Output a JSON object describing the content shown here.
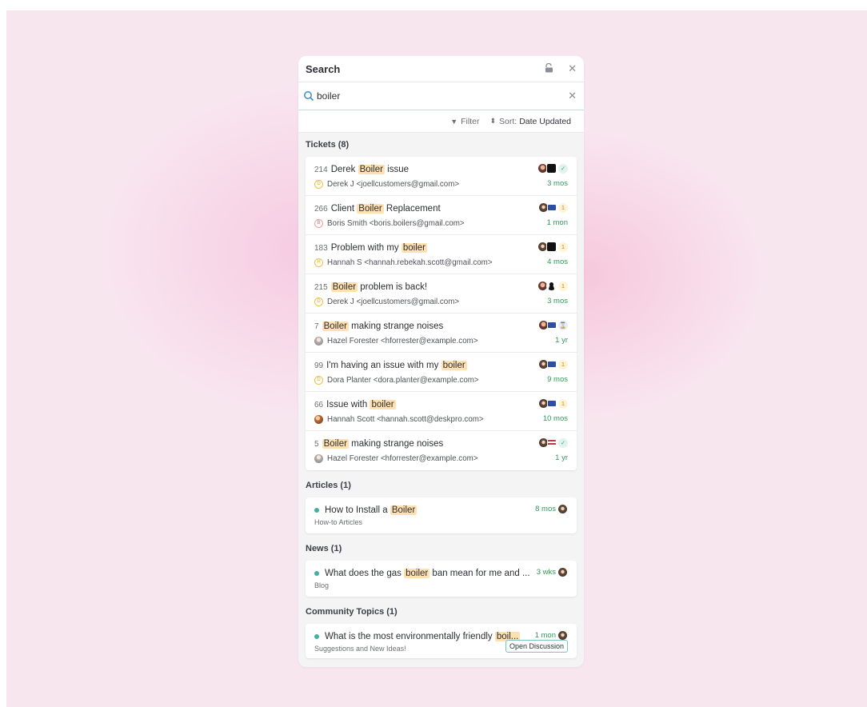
{
  "search_panel": {
    "title": "Search",
    "query": "boiler",
    "filter_label": "Filter",
    "sort_label": "Sort:",
    "sort_value": "Date Updated"
  },
  "sections": {
    "tickets": {
      "title": "Tickets (8)",
      "items": [
        {
          "id": "214",
          "pre": "Derek ",
          "hl": "Boiler",
          "post": " issue",
          "requester": "Derek J <joellcustomers@gmail.com>",
          "initial": "D",
          "age": "3 mos",
          "status": "✓"
        },
        {
          "id": "266",
          "pre": "Client ",
          "hl": "Boiler",
          "post": " Replacement",
          "requester": "Boris Smith <boris.boilers@gmail.com>",
          "initial": "B",
          "age": "1 mon",
          "status": "1"
        },
        {
          "id": "183",
          "pre": "Problem with my ",
          "hl": "boiler",
          "post": "",
          "requester": "Hannah S <hannah.rebekah.scott@gmail.com>",
          "initial": "H",
          "age": "4 mos",
          "status": "1"
        },
        {
          "id": "215",
          "pre": "",
          "hl": "Boiler",
          "post": " problem is back!",
          "requester": "Derek J <joellcustomers@gmail.com>",
          "initial": "D",
          "age": "3 mos",
          "status": "1"
        },
        {
          "id": "7",
          "pre": "",
          "hl": "Boiler",
          "post": " making strange noises",
          "requester": "Hazel Forester <hforrester@example.com>",
          "initial": "",
          "age": "1 yr",
          "status": "⌛"
        },
        {
          "id": "99",
          "pre": "I'm having an issue with my ",
          "hl": "boiler",
          "post": "",
          "requester": "Dora Planter <dora.planter@example.com>",
          "initial": "D",
          "age": "9 mos",
          "status": "1"
        },
        {
          "id": "66",
          "pre": "Issue with ",
          "hl": "boiler",
          "post": "",
          "requester": "Hannah Scott <hannah.scott@deskpro.com>",
          "initial": "",
          "age": "10 mos",
          "status": "1"
        },
        {
          "id": "5",
          "pre": "",
          "hl": "Boiler",
          "post": " making strange noises",
          "requester": "Hazel Forester <hforrester@example.com>",
          "initial": "",
          "age": "1 yr",
          "status": "✓"
        }
      ]
    },
    "articles": {
      "title": "Articles (1)",
      "item": {
        "pre": "How to Install a ",
        "hl": "Boiler",
        "post": "",
        "category": "How-to Articles",
        "age": "8 mos"
      }
    },
    "news": {
      "title": "News (1)",
      "item": {
        "pre": "What does the gas ",
        "hl": "boiler",
        "post": " ban mean for me and ...",
        "category": "Blog",
        "age": "3 wks"
      }
    },
    "community": {
      "title": "Community Topics (1)",
      "item": {
        "pre": "What is the most environmentally friendly ",
        "hl": "boil...",
        "post": "",
        "category": "Suggestions and New Ideas!",
        "age": "1 mon",
        "badge": "Open Discussion"
      }
    }
  },
  "colors": {
    "accent": "#3fb0a4",
    "highlight": "#ffe0b0",
    "age_green": "#2e9a57"
  }
}
